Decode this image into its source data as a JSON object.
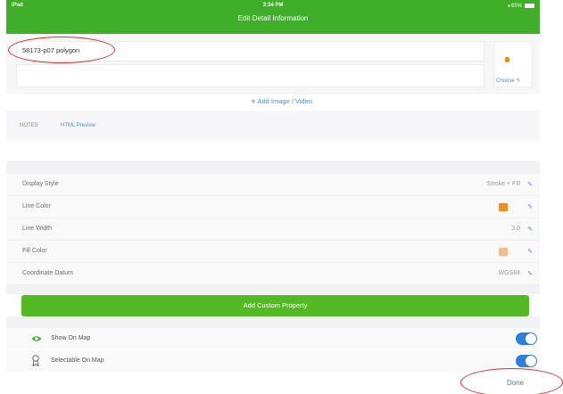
{
  "status_bar": {
    "carrier": "iPad",
    "time": "3:34 PM",
    "battery_text": "◂ 65%",
    "title": "Edit Detail Information",
    "color": "#3fae29"
  },
  "detail": {
    "name_value": "58173-p07 polygon",
    "choose_label": "Choose",
    "add_media_label": "Add Image / Video"
  },
  "notes": {
    "tab_notes": "NOTES",
    "tab_preview": "HTML Preview"
  },
  "properties": [
    {
      "label": "Display Style",
      "value": "Stroke + Fill"
    },
    {
      "label": "Line Color",
      "value": "",
      "swatch_color": "#f28c1c"
    },
    {
      "label": "Line Width",
      "value": "3.0"
    },
    {
      "label": "Fill Color",
      "value": "",
      "swatch_color": "#f5b98a"
    },
    {
      "label": "Coordinate Datum",
      "value": "WGS84"
    }
  ],
  "custom_button_label": "Add Custom Property",
  "toggles": [
    {
      "label": "Show On Map",
      "icon": "eye-icon",
      "on": true
    },
    {
      "label": "Selectable On Map",
      "icon": "ribbon-icon",
      "on": true
    }
  ],
  "done_label": "Done",
  "colors": {
    "accent_blue": "#4a90d9",
    "toggle_blue": "#2f7fe0",
    "green_button": "#53b924",
    "annotation_red": "#d9302c"
  }
}
